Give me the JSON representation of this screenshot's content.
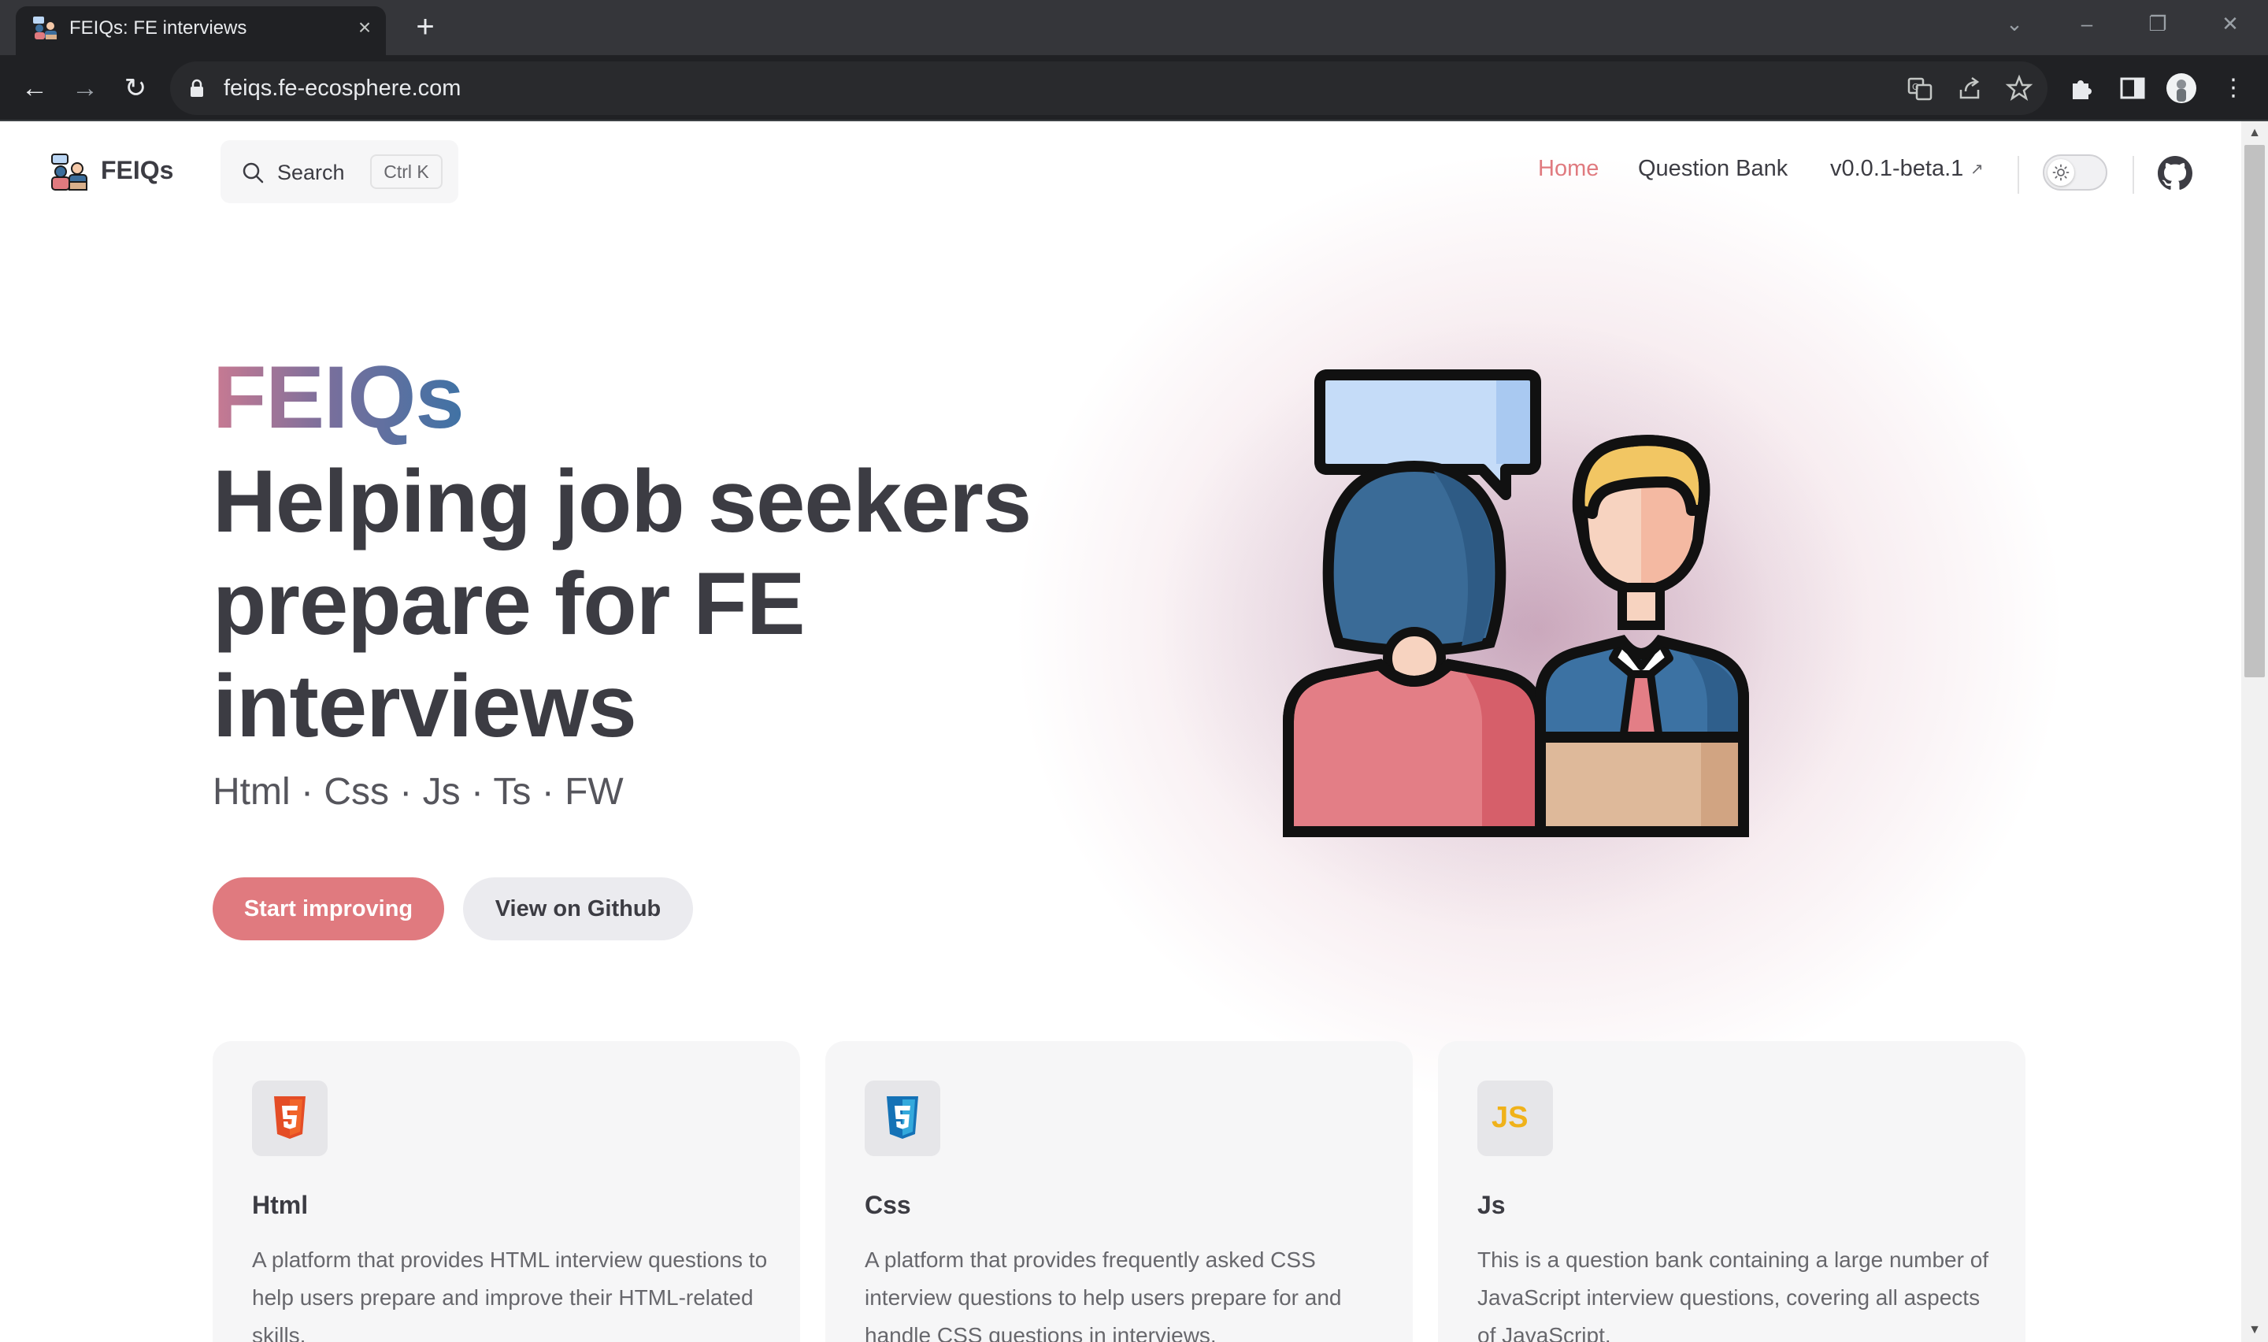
{
  "browser": {
    "tab_title": "FEIQs: FE interviews",
    "url": "feiqs.fe-ecosphere.com"
  },
  "site": {
    "name": "FEIQs",
    "search": {
      "label": "Search",
      "shortcut": "Ctrl K"
    },
    "nav": [
      {
        "label": "Home",
        "active": true
      },
      {
        "label": "Question Bank",
        "active": false
      },
      {
        "label": "v0.0.1-beta.1",
        "active": false
      }
    ],
    "accent_color": "#e07a7f"
  },
  "hero": {
    "brand": "FEIQs",
    "title": "Helping job seekers prepare for FE interviews",
    "tagline": "Html · Css · Js · Ts · FW",
    "primary_button": "Start improving",
    "secondary_button": "View on Github",
    "image_icon": "interview-people-icon"
  },
  "features": [
    {
      "icon": "html5-icon",
      "title": "Html",
      "description": "A platform that provides HTML interview questions to help users prepare and improve their HTML-related skills."
    },
    {
      "icon": "css3-icon",
      "title": "Css",
      "description": "A platform that provides frequently asked CSS interview questions to help users prepare for and handle CSS questions in interviews."
    },
    {
      "icon": "js-icon",
      "icon_text": "JS",
      "title": "Js",
      "description": "This is a question bank containing a large number of JavaScript interview questions, covering all aspects of JavaScript."
    }
  ]
}
